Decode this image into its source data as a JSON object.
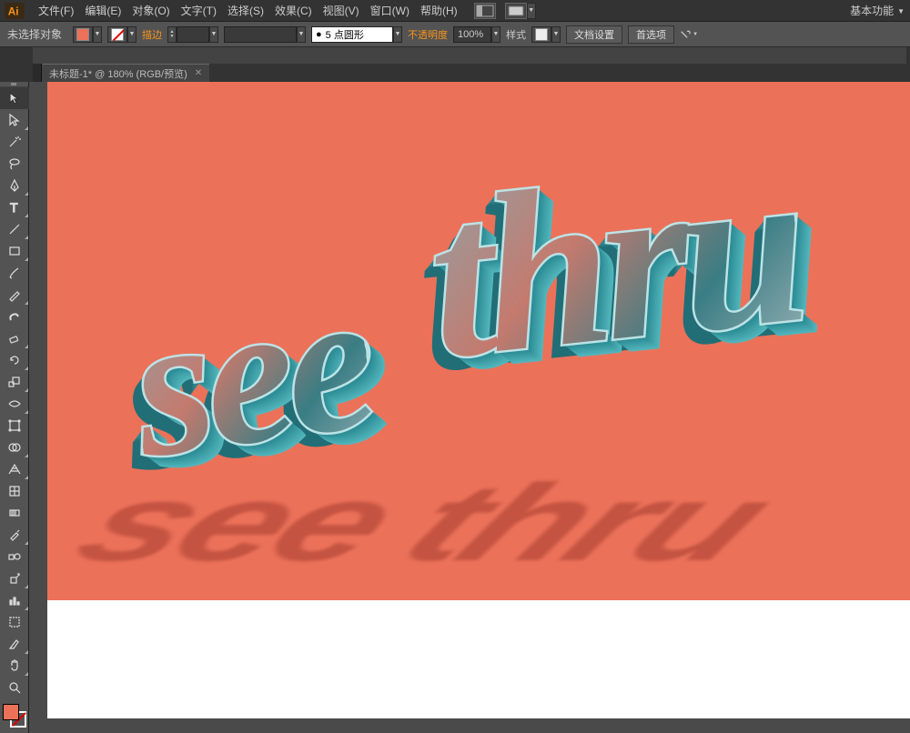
{
  "app": {
    "name": "Ai"
  },
  "menu": {
    "file": "文件(F)",
    "edit": "编辑(E)",
    "object": "对象(O)",
    "type": "文字(T)",
    "select": "选择(S)",
    "effect": "效果(C)",
    "view": "视图(V)",
    "window": "窗口(W)",
    "help": "帮助(H)"
  },
  "workspace": {
    "label": "基本功能"
  },
  "control": {
    "no_selection": "未选择对象",
    "stroke_label": "描边",
    "stroke_weight": "",
    "brush_preset": "5 点圆形",
    "brush_bullet": "●",
    "opacity_label": "不透明度",
    "opacity_value": "100%",
    "style_label": "样式",
    "doc_setup": "文档设置",
    "preferences": "首选项"
  },
  "document": {
    "tab_title": "未标题-1* @ 180% (RGB/预览)"
  },
  "artwork": {
    "word1": "see",
    "word2": "thru",
    "bg_color": "#EC7159",
    "text_color": "#2b8a94"
  },
  "colors": {
    "accent_orange": "#f7941d"
  }
}
